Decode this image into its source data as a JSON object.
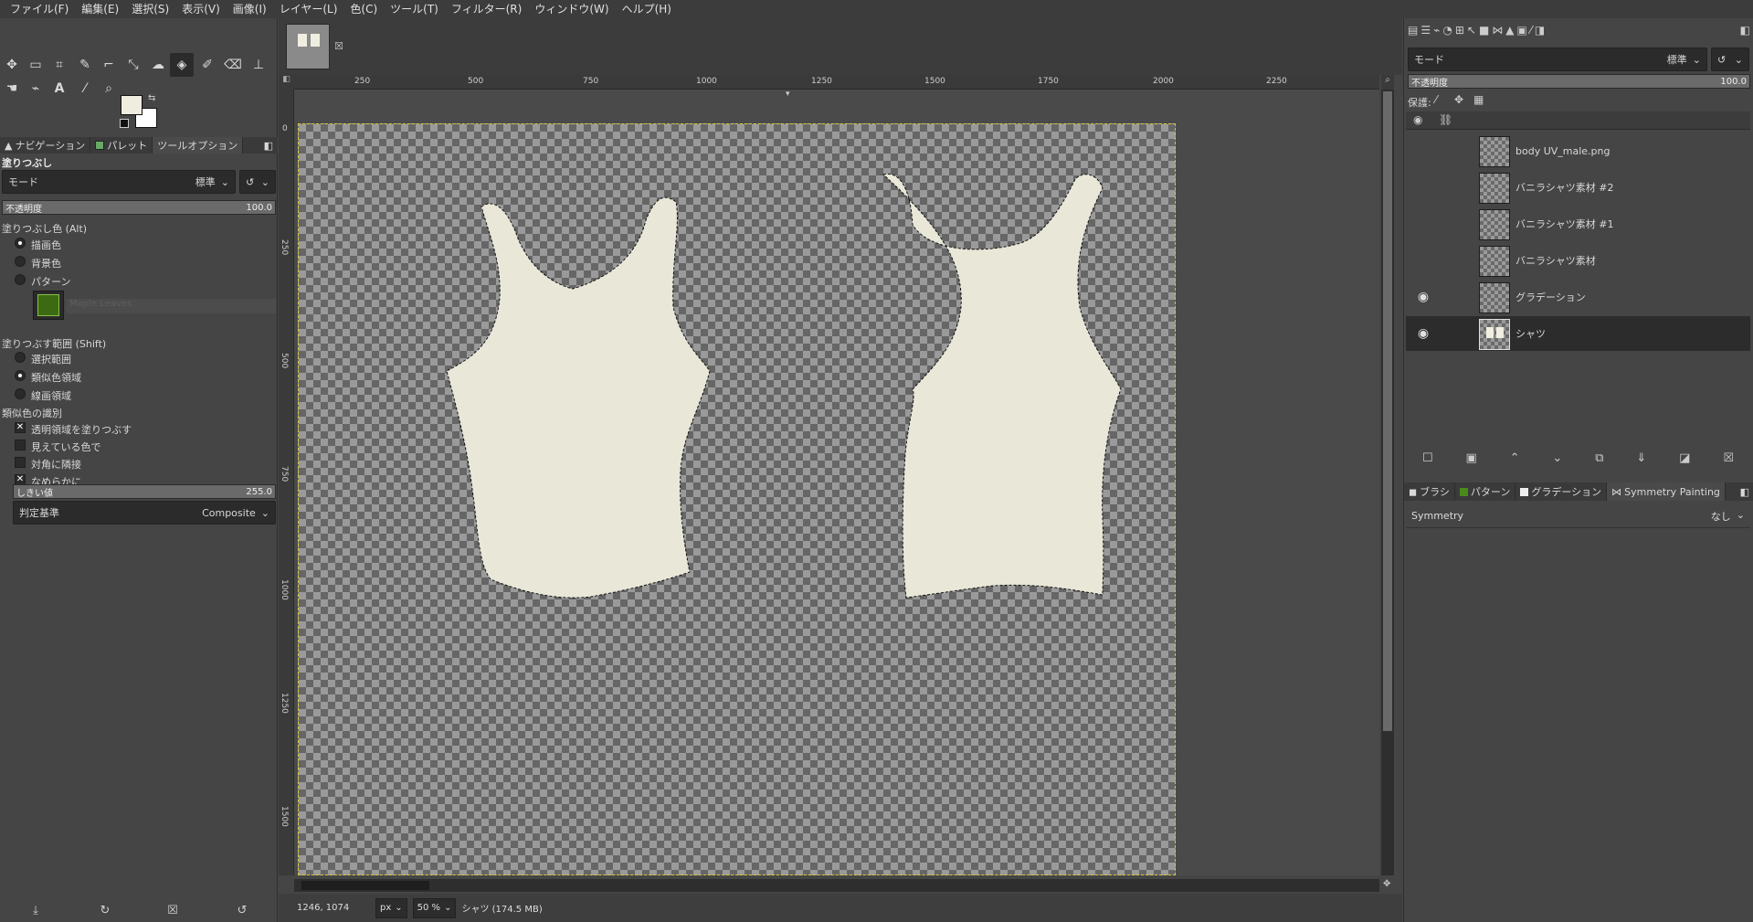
{
  "menu": [
    "ファイル(F)",
    "編集(E)",
    "選択(S)",
    "表示(V)",
    "画像(I)",
    "レイヤー(L)",
    "色(C)",
    "ツール(T)",
    "フィルター(R)",
    "ウィンドウ(W)",
    "ヘルプ(H)"
  ],
  "toolbox": {
    "tools_row1": [
      "move-icon",
      "rect-select-icon",
      "free-select-icon",
      "fuzzy-select-icon",
      "crop-icon",
      "transform-icon",
      "warp-icon",
      "bucket-fill-icon",
      "paintbrush-icon",
      "eraser-icon",
      "clone-icon"
    ],
    "tools_row2": [
      "smudge-icon",
      "paths-icon",
      "text-icon",
      "color-picker-icon",
      "zoom-icon"
    ],
    "fg_color": "#efede0",
    "bg_color": "#ffffff"
  },
  "left_tabs": [
    "ナビゲーション",
    "パレット",
    "ツールオプション"
  ],
  "tool_options": {
    "title": "塗りつぶし",
    "mode_label": "モード",
    "mode_value": "標準",
    "opacity_label": "不透明度",
    "opacity_value": "100.0",
    "fill_color_label": "塗りつぶし色 (Alt)",
    "fill_options": [
      "描画色",
      "背景色",
      "パターン"
    ],
    "fill_selected": 0,
    "pattern_name": "Maple Leaves",
    "area_label": "塗りつぶす範囲 (Shift)",
    "area_options": [
      "選択範囲",
      "類似色領域",
      "線画領域"
    ],
    "area_selected": 1,
    "similar_label": "類似色の識別",
    "checks": [
      {
        "label": "透明領域を塗りつぶす",
        "checked": true
      },
      {
        "label": "見えている色で",
        "checked": false
      },
      {
        "label": "対角に隣接",
        "checked": false
      },
      {
        "label": "なめらかに",
        "checked": true
      }
    ],
    "threshold_label": "しきい値",
    "threshold_value": "255.0",
    "criterion_label": "判定基準",
    "criterion_value": "Composite"
  },
  "ruler": {
    "top": [
      "250",
      "500",
      "750",
      "1000",
      "1250",
      "1500",
      "1750",
      "2000",
      "2250"
    ],
    "left": [
      "0",
      "250",
      "500",
      "750",
      "1000",
      "1250",
      "1500"
    ]
  },
  "canvas": {
    "fill_color": "#e8e7d8"
  },
  "status": {
    "coords": "1246, 1074",
    "unit": "px",
    "zoom": "50 %",
    "info": "シャツ (174.5 MB)"
  },
  "layers_panel": {
    "mode_label": "モード",
    "mode_value": "標準",
    "opacity_label": "不透明度",
    "opacity_value": "100.0",
    "lock_label": "保護:",
    "layers": [
      {
        "name": "body UV_male.png",
        "visible": false,
        "selected": false
      },
      {
        "name": "バニラシャツ素材 #2",
        "visible": false,
        "selected": false
      },
      {
        "name": "バニラシャツ素材 #1",
        "visible": false,
        "selected": false
      },
      {
        "name": "バニラシャツ素材",
        "visible": false,
        "selected": false
      },
      {
        "name": "グラデーション",
        "visible": true,
        "selected": false
      },
      {
        "name": "シャツ",
        "visible": true,
        "selected": true
      }
    ]
  },
  "bottom_tabs": [
    "ブラシ",
    "パターン",
    "グラデーション",
    "Symmetry Painting"
  ],
  "symmetry": {
    "label": "Symmetry",
    "value": "なし"
  }
}
